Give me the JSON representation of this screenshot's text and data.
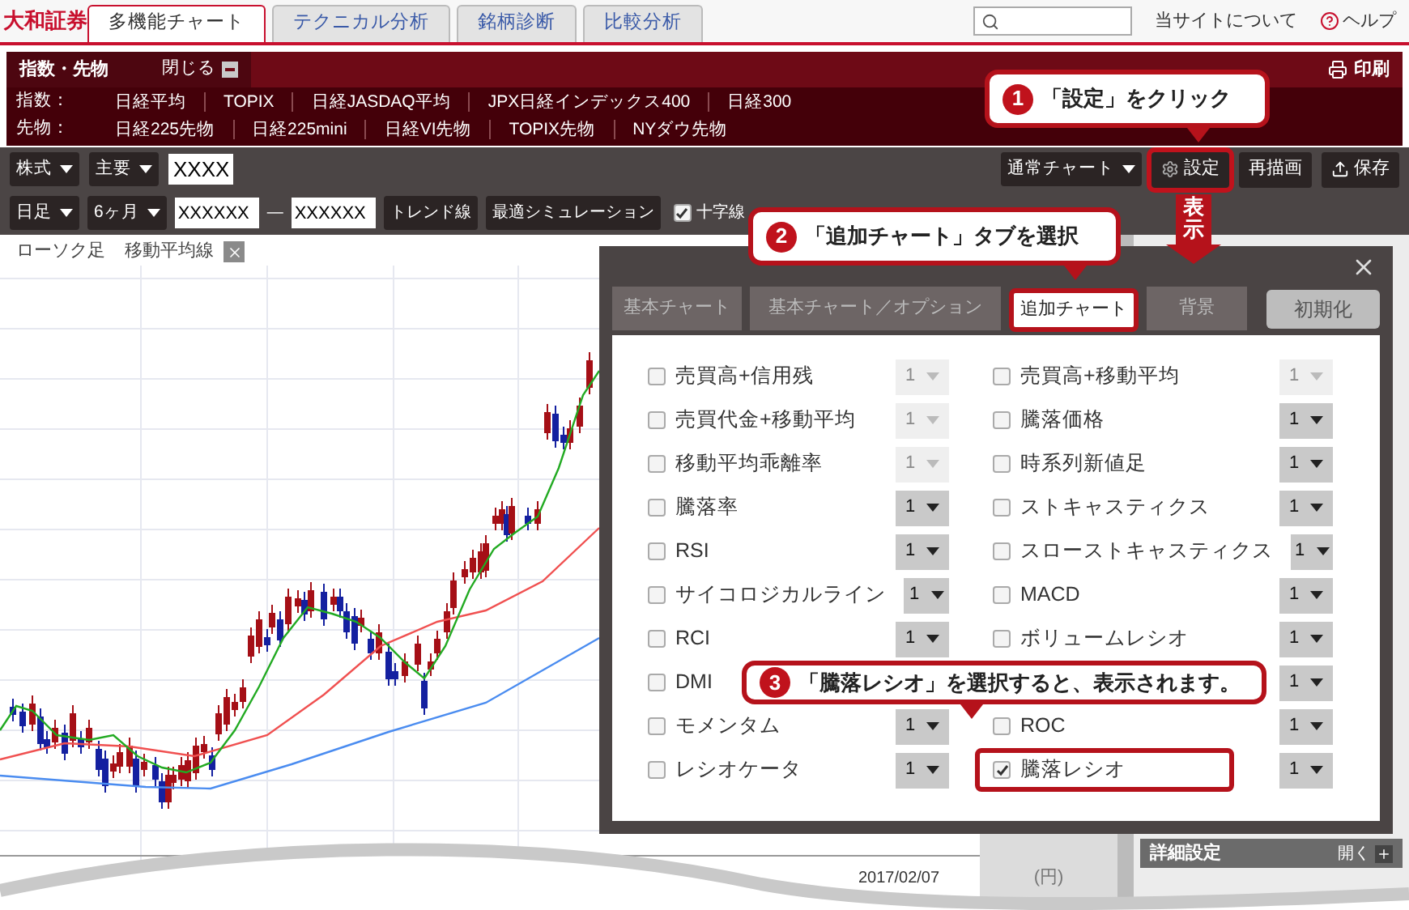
{
  "header": {
    "logo": "大和証券",
    "tabs": [
      {
        "label": "多機能チャート",
        "selected": true
      },
      {
        "label": "テクニカル分析",
        "selected": false
      },
      {
        "label": "銘柄診断",
        "selected": false
      },
      {
        "label": "比較分析",
        "selected": false
      }
    ],
    "links": [
      {
        "label": "当サイトについて",
        "kind": "plain"
      },
      {
        "label": "ヘルプ",
        "kind": "help"
      }
    ]
  },
  "index_panel": {
    "title": "指数・先物",
    "close": "閉じる",
    "print": "印刷",
    "rows": [
      {
        "label": "指数：",
        "items": [
          "日経平均",
          "TOPIX",
          "日経JASDAQ平均",
          "JPX日経インデックス400",
          "日経300"
        ]
      },
      {
        "label": "先物：",
        "items": [
          "日経225先物",
          "日経225mini",
          "日経VI先物",
          "TOPIX先物",
          "NYダウ先物"
        ]
      }
    ]
  },
  "toolbar": {
    "selects": [
      "株式",
      "主要"
    ],
    "code": "XXXX",
    "chart_type": "通常チャート",
    "buttons": [
      {
        "label": "設定",
        "kind": "settings",
        "highlighted": true
      },
      {
        "label": "再描画",
        "kind": "plain",
        "highlighted": false
      },
      {
        "label": "保存",
        "kind": "save",
        "highlighted": false
      }
    ]
  },
  "toolbar2": {
    "selects": [
      "日足",
      "6ヶ月"
    ],
    "from": "XXXXXX",
    "separator": "—",
    "to": "XXXXXX",
    "buttons": [
      "トレンド線",
      "最適シミュレーション"
    ],
    "crosshair": {
      "label": "十字線",
      "checked": true
    }
  },
  "chart": {
    "legend": [
      "ローソク足",
      "移動平均線"
    ],
    "date": "2017/02/07",
    "unit": "(円)"
  },
  "detail_panel": {
    "title": "詳細設定",
    "toggle": "開く"
  },
  "dialog": {
    "tabs": [
      {
        "label": "基本チャート",
        "selected": false
      },
      {
        "label": "基本チャート／オプション",
        "selected": false
      },
      {
        "label": "追加チャート",
        "selected": true
      },
      {
        "label": "背景",
        "selected": false
      }
    ],
    "reset": "初期化",
    "columns": [
      [
        {
          "label": "売買高+信用残",
          "checked": false,
          "value": "1",
          "disabled": true,
          "highlighted": false
        },
        {
          "label": "売買代金+移動平均",
          "checked": false,
          "value": "1",
          "disabled": true,
          "highlighted": false
        },
        {
          "label": "移動平均乖離率",
          "checked": false,
          "value": "1",
          "disabled": true,
          "highlighted": false
        },
        {
          "label": "騰落率",
          "checked": false,
          "value": "1",
          "disabled": false,
          "highlighted": false
        },
        {
          "label": "RSI",
          "checked": false,
          "value": "1",
          "disabled": false,
          "highlighted": false
        },
        {
          "label": "サイコロジカルライン",
          "checked": false,
          "value": "1",
          "disabled": false,
          "highlighted": false
        },
        {
          "label": "RCI",
          "checked": false,
          "value": "1",
          "disabled": false,
          "highlighted": false
        },
        {
          "label": "DMI",
          "checked": false,
          "highlighted": false
        },
        {
          "label": "モメンタム",
          "checked": false,
          "value": "1",
          "disabled": false,
          "highlighted": false
        },
        {
          "label": "レシオケータ",
          "checked": false,
          "value": "1",
          "disabled": false,
          "highlighted": false
        }
      ],
      [
        {
          "label": "売買高+移動平均",
          "checked": false,
          "value": "1",
          "disabled": true,
          "highlighted": false
        },
        {
          "label": "騰落価格",
          "checked": false,
          "value": "1",
          "disabled": false,
          "highlighted": false
        },
        {
          "label": "時系列新値足",
          "checked": false,
          "value": "1",
          "disabled": false,
          "highlighted": false
        },
        {
          "label": "ストキャスティクス",
          "checked": false,
          "value": "1",
          "disabled": false,
          "highlighted": false
        },
        {
          "label": "スローストキャスティクス",
          "checked": false,
          "value": "1",
          "disabled": false,
          "highlighted": false
        },
        {
          "label": "MACD",
          "checked": false,
          "value": "1",
          "disabled": false,
          "highlighted": false
        },
        {
          "label": "ボリュームレシオ",
          "checked": false,
          "value": "1",
          "disabled": false,
          "highlighted": false
        },
        {
          "value": "1",
          "disabled": false
        },
        {
          "label": "ROC",
          "checked": false,
          "value": "1",
          "disabled": false,
          "highlighted": false
        },
        {
          "label": "騰落レシオ",
          "checked": true,
          "value": "1",
          "disabled": false,
          "highlighted": true
        }
      ]
    ]
  },
  "callouts": [
    {
      "number": "1",
      "text": "「設定」をクリック"
    },
    {
      "number": "2",
      "text": "「追加チャート」タブを選択"
    },
    {
      "number": "3",
      "text": "「騰落レシオ」を選択すると、表示されます。"
    }
  ],
  "display_arrow": "表示"
}
